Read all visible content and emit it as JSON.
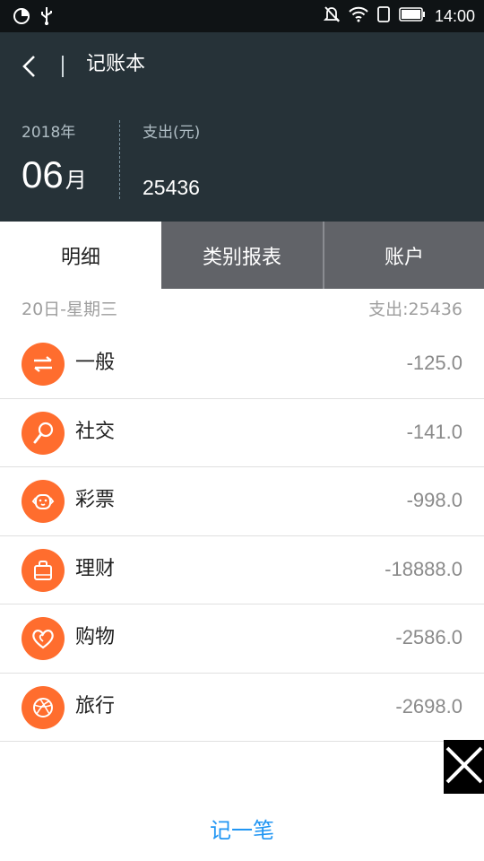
{
  "status_bar": {
    "time": "14:00",
    "icons": [
      "pie-icon",
      "usb-icon",
      "mute-icon",
      "wifi-icon",
      "sim-icon",
      "battery-icon"
    ]
  },
  "header": {
    "title": "记账本",
    "back_icon": "chevron-left-icon",
    "year": "2018年",
    "month": "06",
    "month_suffix": "月",
    "expense_label": "支出(元)",
    "expense_value": "25436"
  },
  "tabs": [
    {
      "label": "明细",
      "selected": true
    },
    {
      "label": "类别报表",
      "selected": false
    },
    {
      "label": "账户",
      "selected": false
    }
  ],
  "day": {
    "label": "20日-星期三",
    "total": "支出:25436"
  },
  "entries": [
    {
      "name": "一般",
      "amount": "-125.0",
      "icon": "transfer-icon"
    },
    {
      "name": "社交",
      "amount": "-141.0",
      "icon": "microphone-icon"
    },
    {
      "name": "彩票",
      "amount": "-998.0",
      "icon": "dog-face-icon"
    },
    {
      "name": "理财",
      "amount": "-18888.0",
      "icon": "bag-icon"
    },
    {
      "name": "购物",
      "amount": "-2586.0",
      "icon": "heart-icon"
    },
    {
      "name": "旅行",
      "amount": "-2698.0",
      "icon": "basketball-icon"
    }
  ],
  "overlay": {
    "icon": "close-icon"
  },
  "bottom": {
    "record_label": "记一笔"
  },
  "colors": {
    "header_bg": "#263238",
    "status_bg": "#0f1315",
    "accent_orange": "#ff6d2e",
    "tab_inactive_bg": "#616368",
    "link_blue": "#2196f3"
  }
}
